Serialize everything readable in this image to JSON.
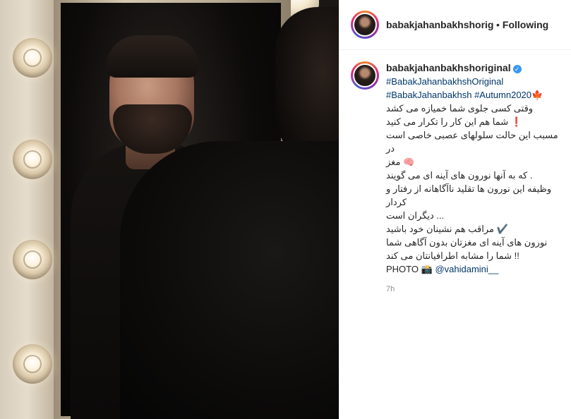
{
  "header": {
    "username": "babakjahanbakhshoriginal",
    "separator": "•",
    "follow_status": "Following"
  },
  "caption": {
    "username": "babakjahanbakhshoriginal",
    "verified_glyph": "✓",
    "hashtag_line1": "#BabakJahanbakhshOriginal",
    "hashtag_line2a": "#BabakJahanbakhsh",
    "hashtag_line2b": "#Autumn2020",
    "hashtag_line2_emoji": "🍁",
    "lines": [
      "وقتی کسی جلوی شما خمیازه می کشد",
      "❗️ شما هم این کار را تکرار می کنید",
      "مسبب این حالت سلولهای عصبی خاصی است در",
      "🧠 مغز",
      ". که به آنها نورون های آینه ای می گویند",
      "وظیفه این نورون ها تقلید ناآگاهانه از رفتار و کردار",
      "... دیگران است",
      "✔️ مراقب هم نشینان خود باشید",
      "نورون های آینه ای مغزتان بدون آگاهی شما",
      "!! شما را مشابه اطرافیانتان می کند"
    ],
    "photo_label": "PHOTO",
    "photo_emoji": "📸",
    "photo_credit": "@vahidamini__"
  },
  "timestamp": "7h",
  "icons": {
    "avatar": "profile-avatar",
    "verified": "verified-badge-icon",
    "camera": "camera-icon",
    "maple": "maple-leaf-icon"
  },
  "colors": {
    "link": "#00376b",
    "verified": "#3897f0",
    "muted": "#8e8e8e"
  }
}
